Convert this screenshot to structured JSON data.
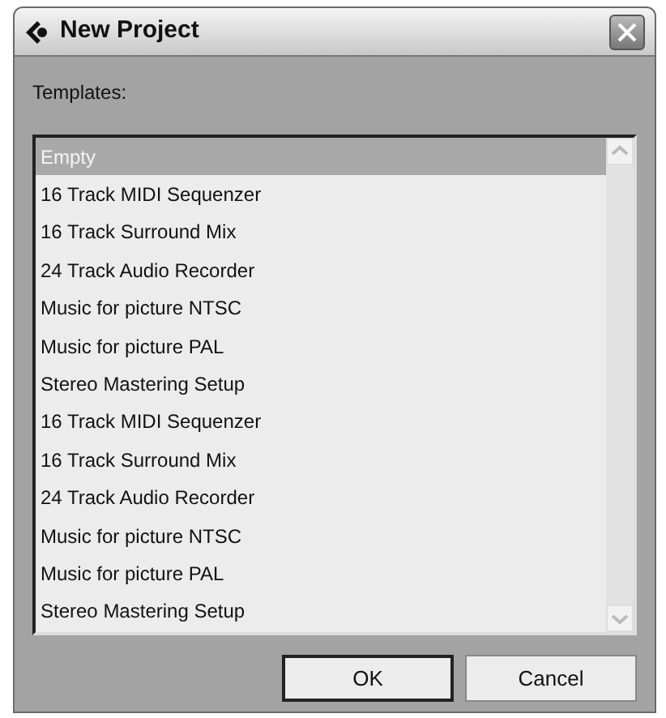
{
  "window": {
    "title": "New Project"
  },
  "label": "Templates:",
  "templates": [
    {
      "name": "Empty",
      "selected": true
    },
    {
      "name": "16 Track MIDI Sequenzer",
      "selected": false
    },
    {
      "name": "16 Track Surround Mix",
      "selected": false
    },
    {
      "name": "24 Track Audio Recorder",
      "selected": false
    },
    {
      "name": "Music for picture NTSC",
      "selected": false
    },
    {
      "name": "Music for picture PAL",
      "selected": false
    },
    {
      "name": "Stereo Mastering Setup",
      "selected": false
    },
    {
      "name": "16 Track MIDI Sequenzer",
      "selected": false
    },
    {
      "name": "16 Track Surround Mix",
      "selected": false
    },
    {
      "name": "24 Track Audio Recorder",
      "selected": false
    },
    {
      "name": "Music for picture NTSC",
      "selected": false
    },
    {
      "name": "Music for picture PAL",
      "selected": false
    },
    {
      "name": "Stereo Mastering Setup",
      "selected": false
    }
  ],
  "buttons": [
    {
      "label": "OK",
      "default": true
    },
    {
      "label": "Cancel",
      "default": false
    }
  ]
}
